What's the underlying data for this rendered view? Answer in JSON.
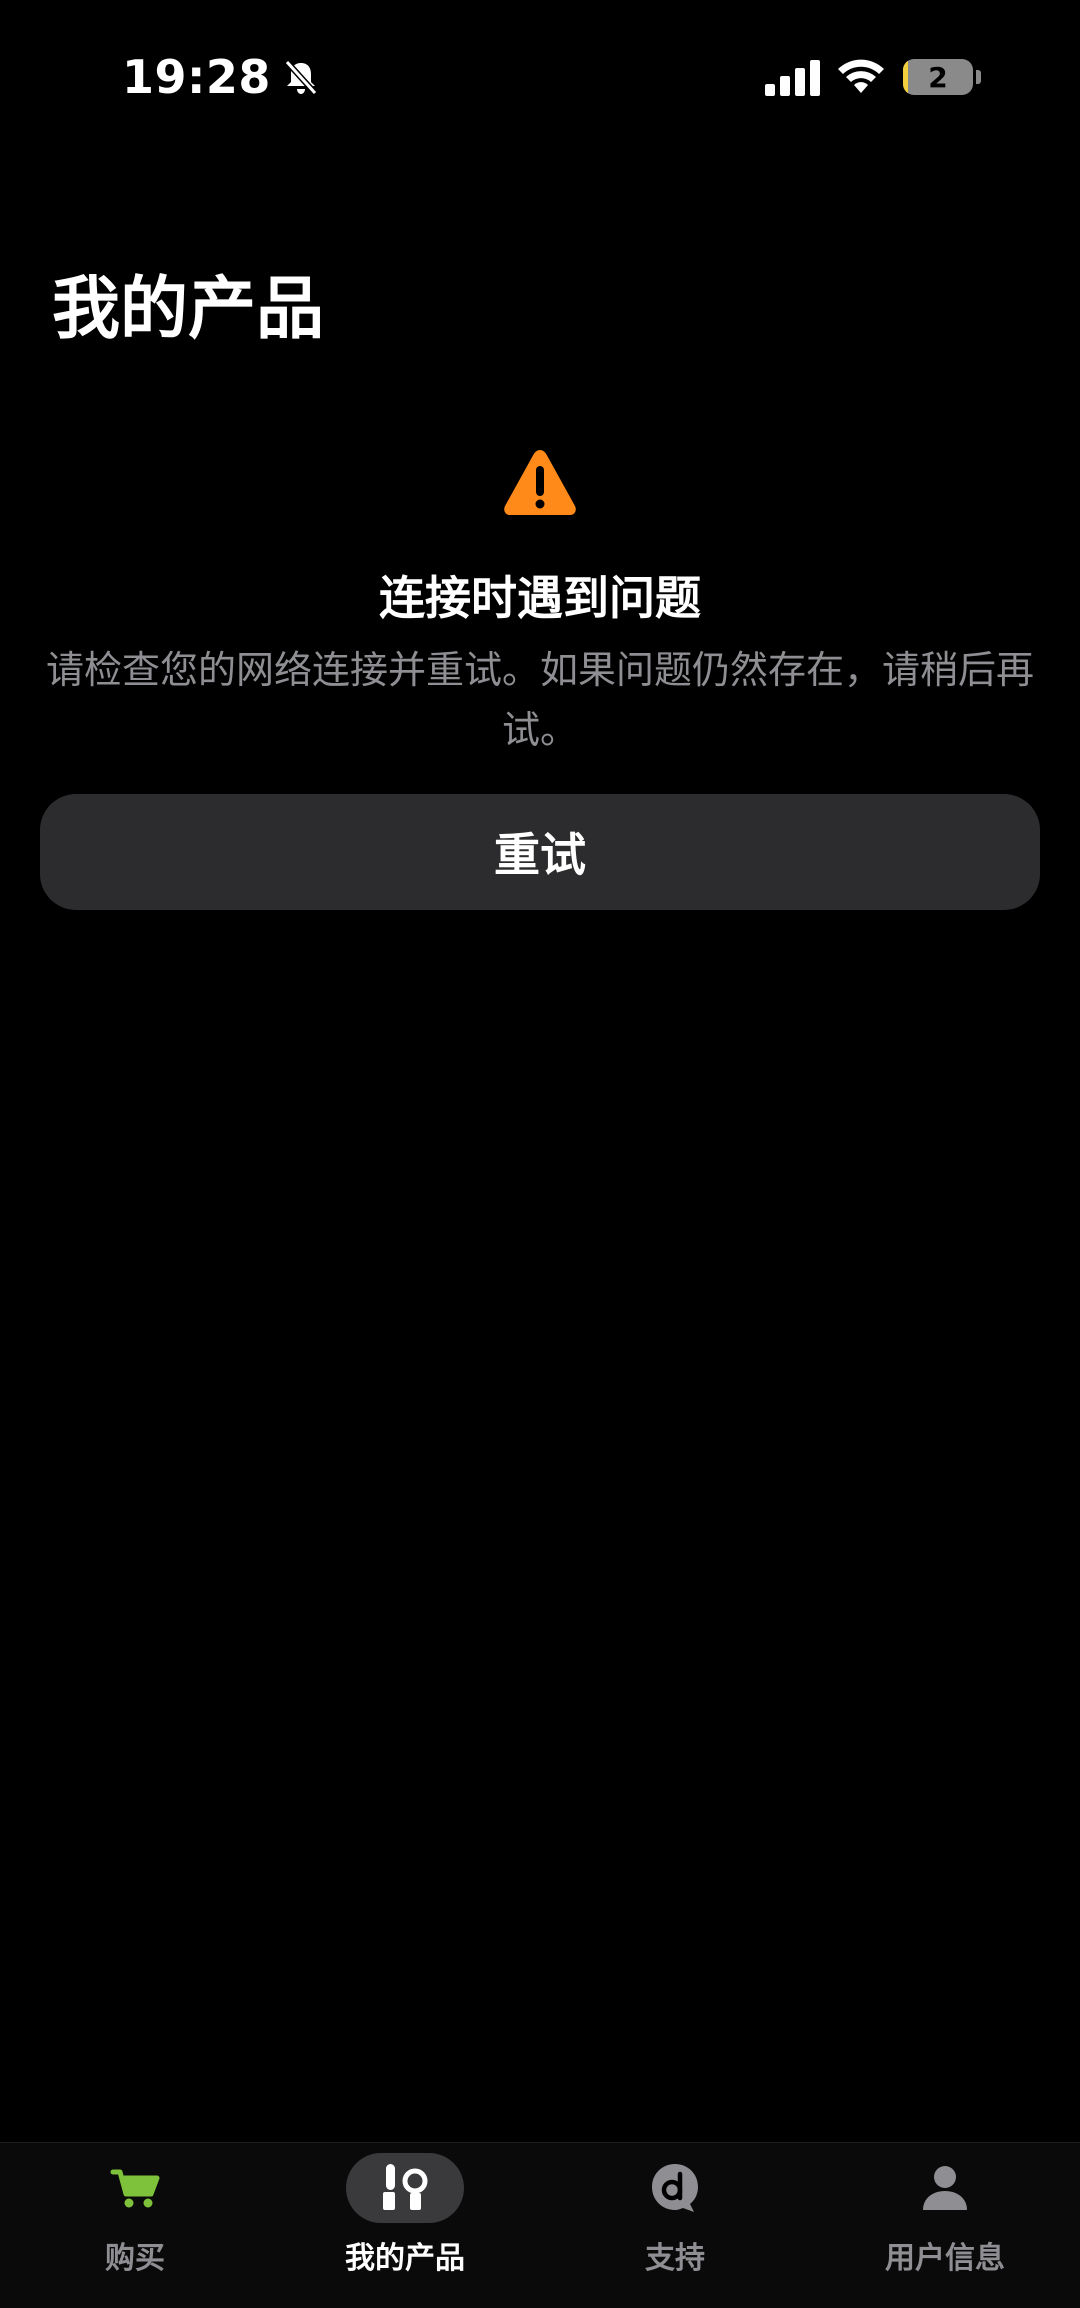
{
  "status_bar": {
    "time": "19:28",
    "battery_level": "2",
    "icons": [
      "bell-slash-icon",
      "cellular-signal-icon",
      "wifi-icon",
      "battery-icon"
    ]
  },
  "page": {
    "title": "我的产品"
  },
  "error": {
    "icon": "warning-triangle-icon",
    "title": "连接时遇到问题",
    "message": "请检查您的网络连接并重试。如果问题仍然存在，请稍后再试。",
    "retry_label": "重试"
  },
  "tab_bar": {
    "tabs": [
      {
        "label": "购买",
        "icon": "cart-icon",
        "active": false
      },
      {
        "label": "我的产品",
        "icon": "products-icon",
        "active": true
      },
      {
        "label": "支持",
        "icon": "support-icon",
        "active": false
      },
      {
        "label": "用户信息",
        "icon": "person-icon",
        "active": false
      }
    ]
  },
  "colors": {
    "background": "#000000",
    "warning": "#ff8a1a",
    "cart_green": "#7ec13a",
    "button_bg": "#2c2c2e",
    "secondary_text": "#8e8e93",
    "battery_low": "#f4d03f"
  }
}
